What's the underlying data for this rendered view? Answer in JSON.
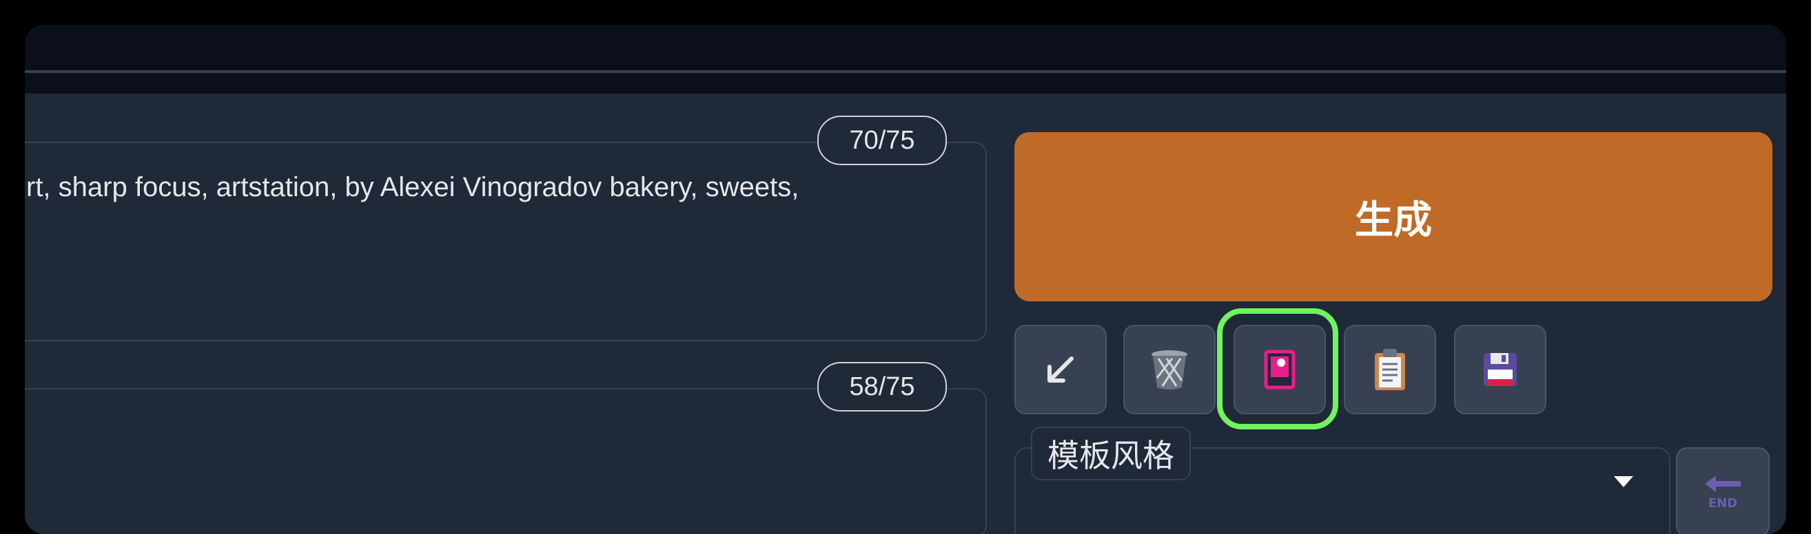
{
  "prompt": {
    "positive_text": "rt, sharp focus, artstation, by Alexei Vinogradov bakery, sweets,",
    "positive_token_count": "70/75",
    "negative_text": "",
    "negative_token_count": "58/75"
  },
  "actions": {
    "generate_label": "生成"
  },
  "toolbar": {
    "buttons": [
      {
        "icon": "arrow-down-left-icon"
      },
      {
        "icon": "trash-bin-icon"
      },
      {
        "icon": "image-card-icon",
        "highlighted": true
      },
      {
        "icon": "clipboard-icon"
      },
      {
        "icon": "save-floppy-icon"
      }
    ]
  },
  "styles": {
    "label": "模板风格",
    "selected_value": "",
    "apply_icon": "end-arrow-icon"
  },
  "colors": {
    "generate": "#c06a27",
    "highlight": "#6ef560",
    "background": "#1f2937"
  }
}
